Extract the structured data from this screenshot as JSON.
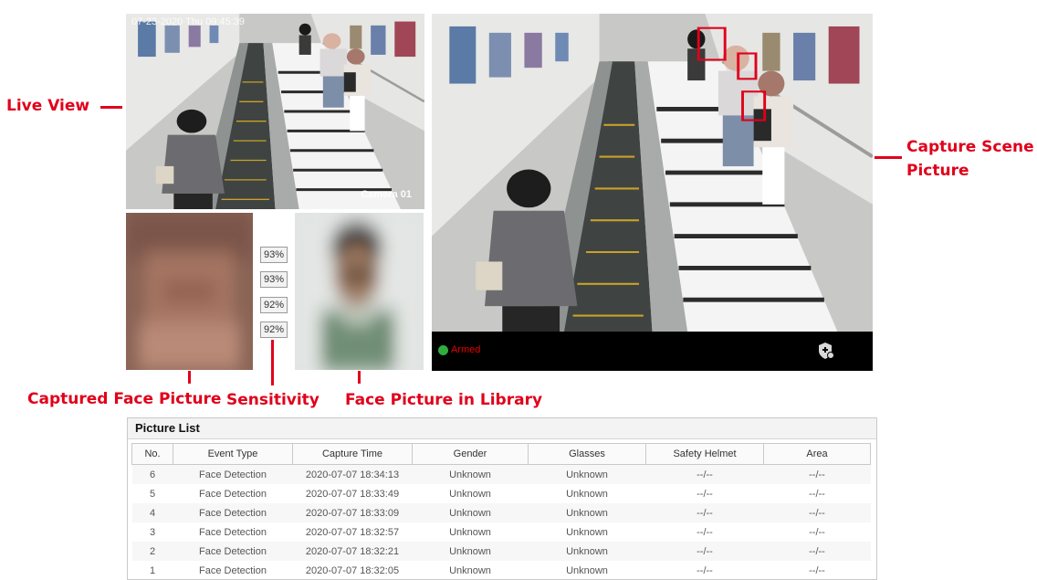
{
  "live_view": {
    "osd_time": "07-23-2020 Thu 09:45:39",
    "osd_camera": "Camera 01"
  },
  "similarity": [
    "93%",
    "93%",
    "92%",
    "92%"
  ],
  "status": {
    "armed_label": "Armed",
    "armed_color": "#2fae3e",
    "armed_text_color": "#e60000"
  },
  "annotations": {
    "live_view": "Live View",
    "capture_scene": "Capture Scene\nPicture",
    "captured_face": "Captured Face Picture",
    "sensitivity": "Sensitivity",
    "face_library": "Face Picture in Library"
  },
  "picture_list": {
    "title": "Picture List",
    "columns": [
      "No.",
      "Event Type",
      "Capture Time",
      "Gender",
      "Glasses",
      "Safety Helmet",
      "Area"
    ],
    "rows": [
      [
        "6",
        "Face Detection",
        "2020-07-07 18:34:13",
        "Unknown",
        "Unknown",
        "--/--",
        "--/--"
      ],
      [
        "5",
        "Face Detection",
        "2020-07-07 18:33:49",
        "Unknown",
        "Unknown",
        "--/--",
        "--/--"
      ],
      [
        "4",
        "Face Detection",
        "2020-07-07 18:33:09",
        "Unknown",
        "Unknown",
        "--/--",
        "--/--"
      ],
      [
        "3",
        "Face Detection",
        "2020-07-07 18:32:57",
        "Unknown",
        "Unknown",
        "--/--",
        "--/--"
      ],
      [
        "2",
        "Face Detection",
        "2020-07-07 18:32:21",
        "Unknown",
        "Unknown",
        "--/--",
        "--/--"
      ],
      [
        "1",
        "Face Detection",
        "2020-07-07 18:32:05",
        "Unknown",
        "Unknown",
        "--/--",
        "--/--"
      ]
    ]
  },
  "colors": {
    "annotation": "#e0001b",
    "face_box": "#e0001b"
  }
}
